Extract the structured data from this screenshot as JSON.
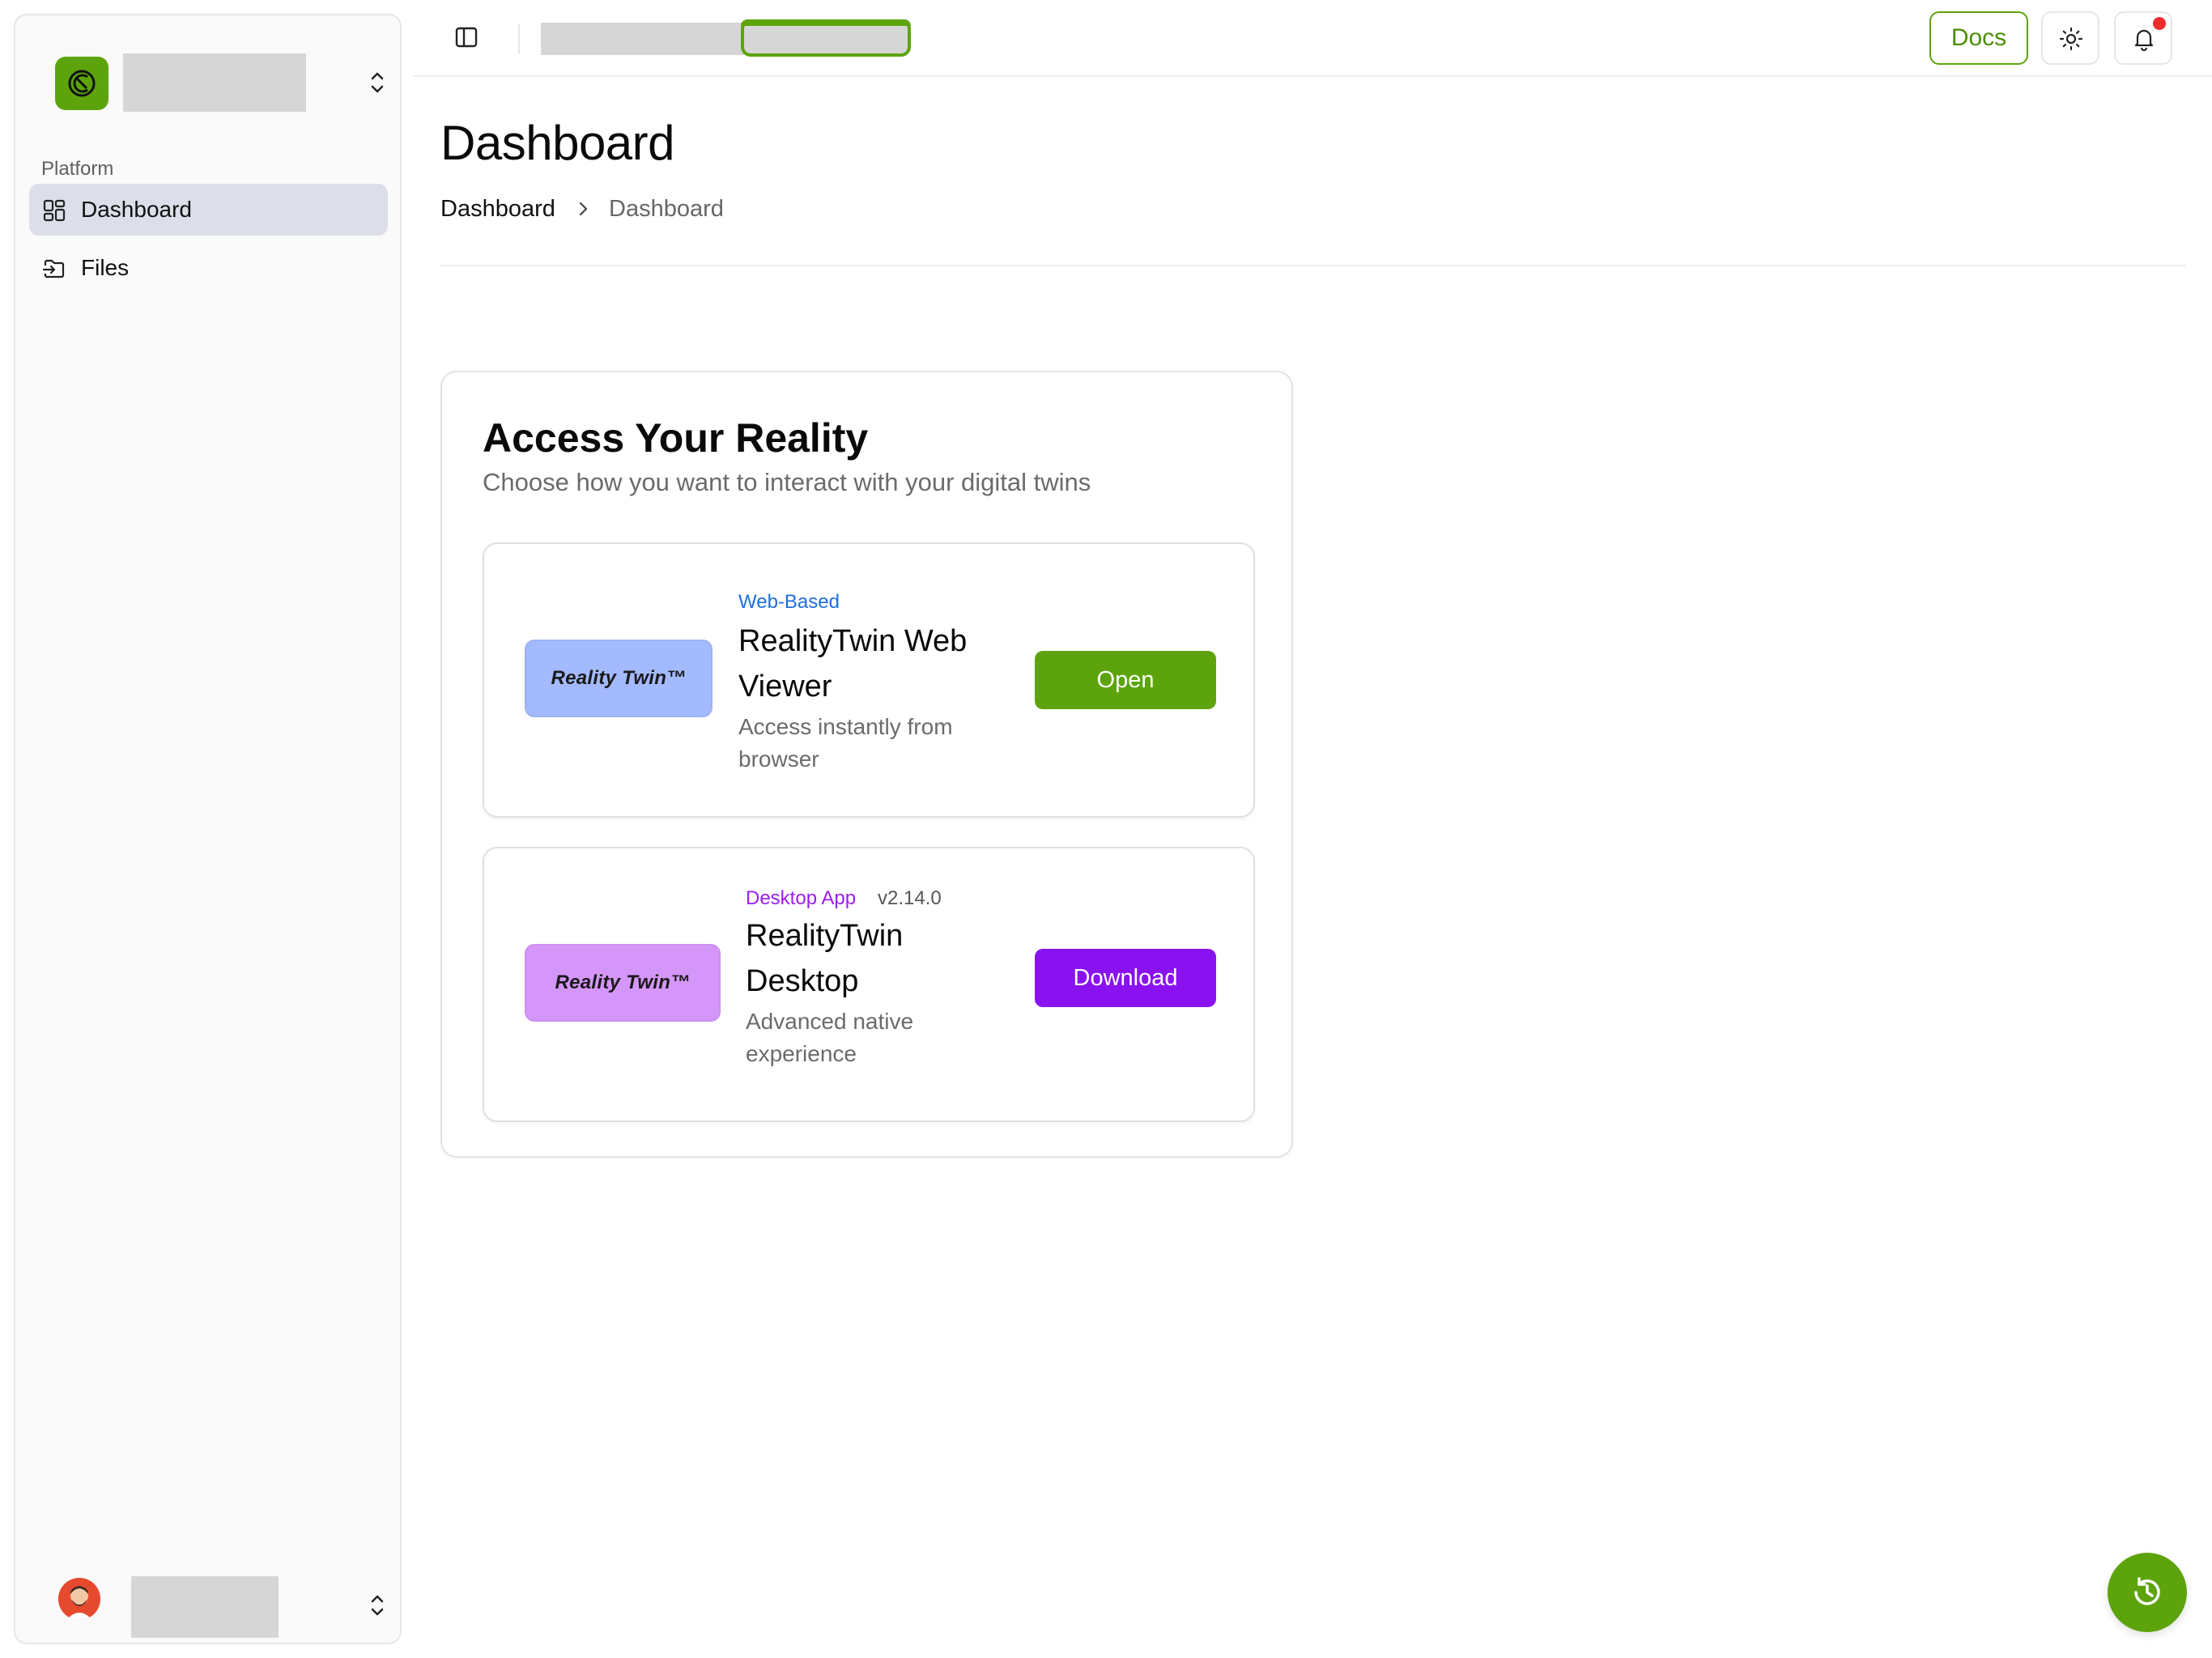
{
  "sidebar": {
    "section_label": "Platform",
    "items": [
      {
        "label": "Dashboard",
        "icon": "layout-dashboard-icon",
        "active": true
      },
      {
        "label": "Files",
        "icon": "folder-input-icon",
        "active": false
      }
    ]
  },
  "topbar": {
    "docs_label": "Docs"
  },
  "page": {
    "title": "Dashboard",
    "breadcrumb": [
      "Dashboard",
      "Dashboard"
    ]
  },
  "access": {
    "title": "Access Your Reality",
    "subtitle": "Choose how you want to interact with your digital twins",
    "options": [
      {
        "tag": "Web-Based",
        "title_line1": "RealityTwin Web",
        "title_line2": "Viewer",
        "desc_line1": "Access instantly from",
        "desc_line2": "browser",
        "logo_text": "Reality Twin™",
        "button_label": "Open"
      },
      {
        "tag": "Desktop App",
        "version": "v2.14.0",
        "title_line1": "RealityTwin",
        "title_line2": "Desktop",
        "desc_line1": "Advanced native",
        "desc_line2": "experience",
        "logo_text": "Reality Twin™",
        "button_label": "Download"
      }
    ]
  },
  "colors": {
    "brand_green": "#5da40c",
    "desktop_purple": "#8a12f0",
    "web_blue": "#1d6fe0",
    "web_tile": "#a3baff",
    "desktop_tile": "#d596f9",
    "notification_dot": "#ef2b2b"
  }
}
